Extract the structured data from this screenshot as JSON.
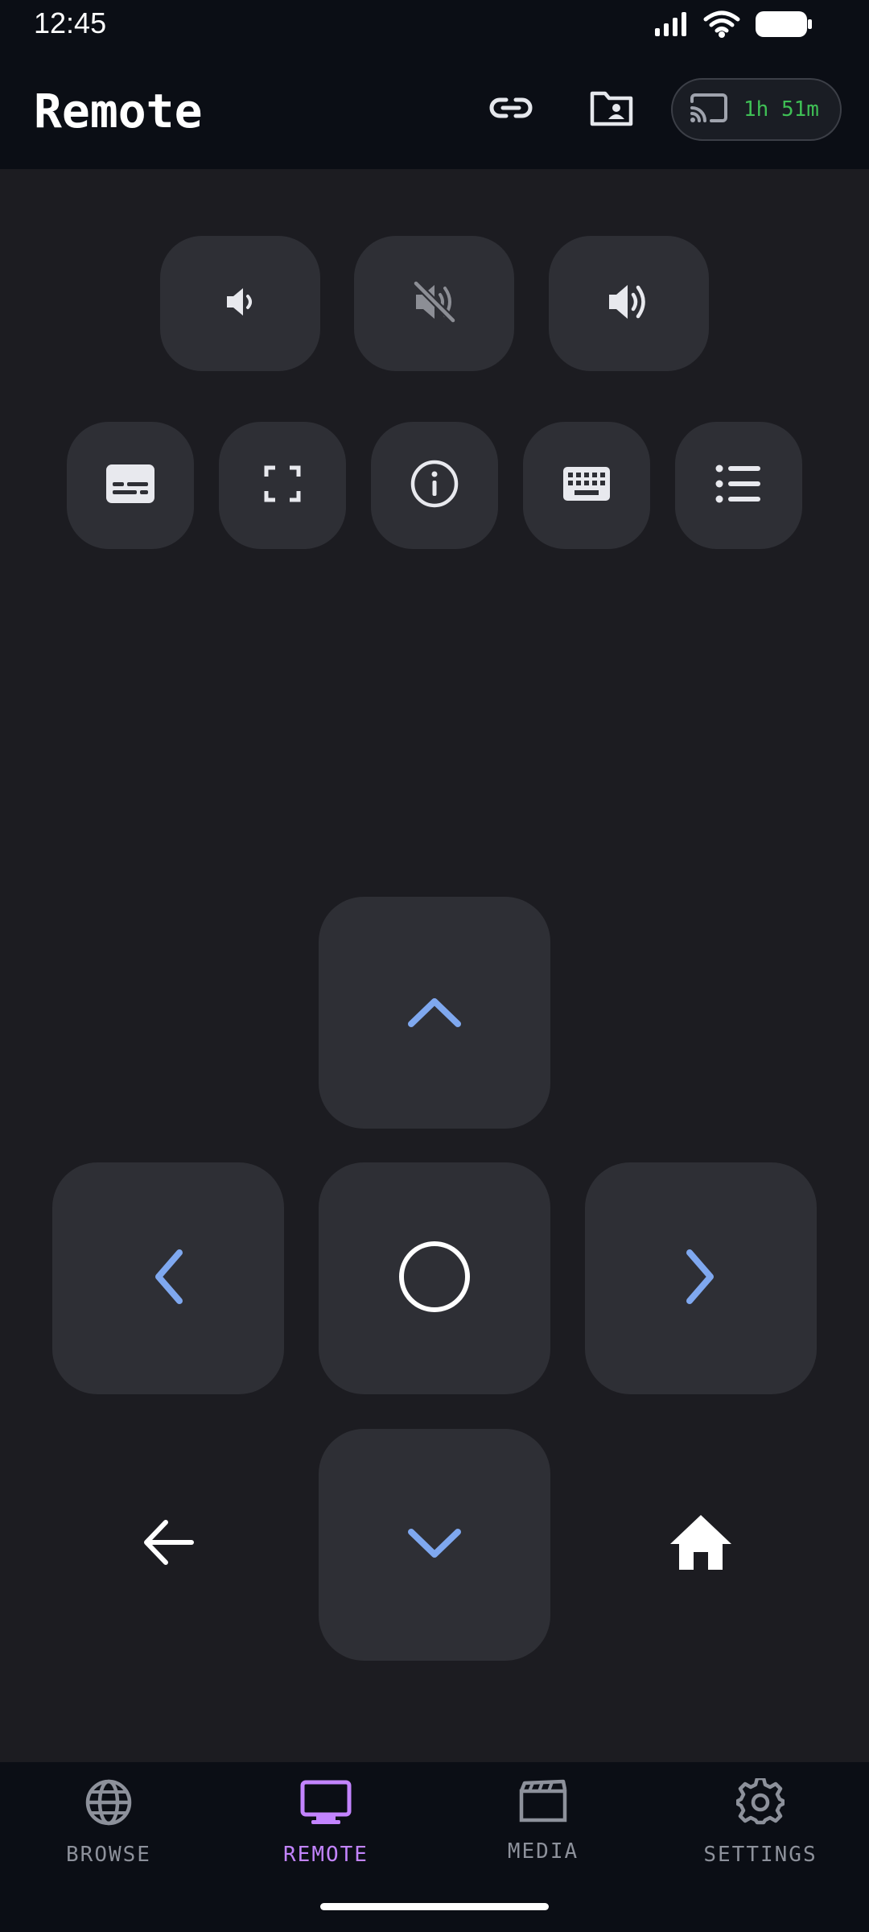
{
  "status_bar": {
    "time": "12:45"
  },
  "header": {
    "title": "Remote",
    "cast_time": "1h 51m"
  },
  "volume_controls": [
    "volume-down",
    "mute",
    "volume-up"
  ],
  "actions": [
    "subtitles",
    "fullscreen",
    "info",
    "keyboard",
    "menu-list"
  ],
  "dpad": [
    "up",
    "left",
    "ok",
    "right",
    "down"
  ],
  "colors": {
    "accent_active": "#c384ff",
    "arrow_blue": "#7fa8ef",
    "cast_green": "#3fbf55",
    "button_bg": "#2e2f35"
  },
  "bottom_nav": {
    "items": [
      {
        "label": "BROWSE",
        "icon": "globe-icon"
      },
      {
        "label": "REMOTE",
        "icon": "tv-icon",
        "active": true
      },
      {
        "label": "MEDIA",
        "icon": "clapperboard-icon"
      },
      {
        "label": "SETTINGS",
        "icon": "gear-icon"
      }
    ]
  }
}
